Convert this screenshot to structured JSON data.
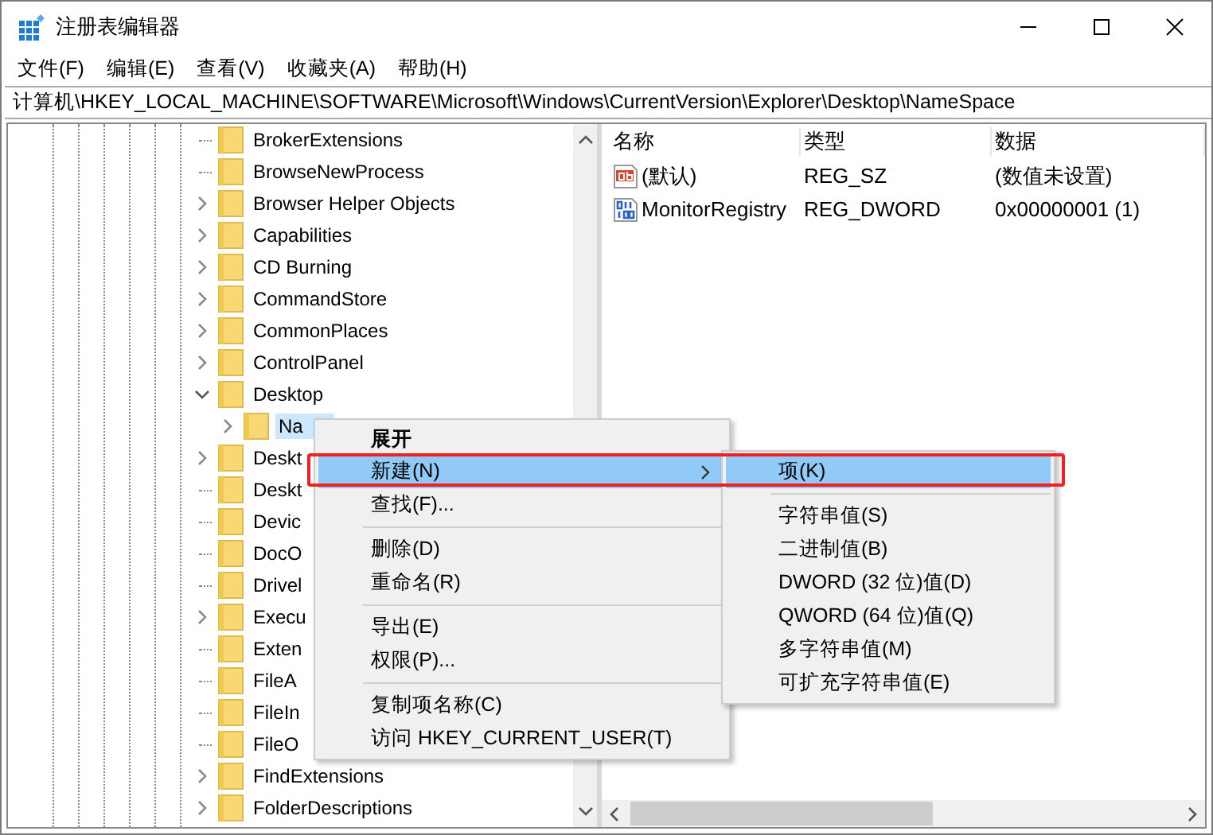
{
  "window": {
    "title": "注册表编辑器"
  },
  "menu_bar": [
    "文件(F)",
    "编辑(E)",
    "查看(V)",
    "收藏夹(A)",
    "帮助(H)"
  ],
  "address": "计算机\\HKEY_LOCAL_MACHINE\\SOFTWARE\\Microsoft\\Windows\\CurrentVersion\\Explorer\\Desktop\\NameSpace",
  "tree": [
    {
      "label": "BrokerExtensions",
      "kind": "leaf",
      "selected": false
    },
    {
      "label": "BrowseNewProcess",
      "kind": "leaf",
      "selected": false
    },
    {
      "label": "Browser Helper Objects",
      "kind": "closed",
      "selected": false
    },
    {
      "label": "Capabilities",
      "kind": "closed",
      "selected": false
    },
    {
      "label": "CD Burning",
      "kind": "closed",
      "selected": false
    },
    {
      "label": "CommandStore",
      "kind": "closed",
      "selected": false
    },
    {
      "label": "CommonPlaces",
      "kind": "closed",
      "selected": false
    },
    {
      "label": "ControlPanel",
      "kind": "closed",
      "selected": false
    },
    {
      "label": "Desktop",
      "kind": "open",
      "selected": false,
      "children": [
        {
          "label": "Na",
          "kind": "closed",
          "selected": true
        }
      ]
    },
    {
      "label": "Deskt",
      "kind": "closed",
      "selected": false
    },
    {
      "label": "Deskt",
      "kind": "leaf",
      "selected": false
    },
    {
      "label": "Devic",
      "kind": "leaf",
      "selected": false
    },
    {
      "label": "DocO",
      "kind": "leaf",
      "selected": false
    },
    {
      "label": "Drivel",
      "kind": "leaf",
      "selected": false
    },
    {
      "label": "Execu",
      "kind": "closed",
      "selected": false
    },
    {
      "label": "Exten",
      "kind": "leaf",
      "selected": false
    },
    {
      "label": "FileA",
      "kind": "leaf",
      "selected": false
    },
    {
      "label": "FileIn",
      "kind": "leaf",
      "selected": false
    },
    {
      "label": "FileO",
      "kind": "leaf",
      "selected": false
    },
    {
      "label": "FindExtensions",
      "kind": "closed",
      "selected": false
    },
    {
      "label": "FolderDescriptions",
      "kind": "closed",
      "selected": false
    }
  ],
  "values": {
    "columns": [
      "名称",
      "类型",
      "数据"
    ],
    "rows": [
      {
        "kind": "string",
        "name": "(默认)",
        "type": "REG_SZ",
        "data": "(数值未设置)"
      },
      {
        "kind": "binary",
        "name": "MonitorRegistry",
        "type": "REG_DWORD",
        "data": "0x00000001 (1)"
      }
    ]
  },
  "context_menu": [
    {
      "kind": "item",
      "label": "展开",
      "bold": true,
      "selected": false,
      "submenu": false
    },
    {
      "kind": "item",
      "label": "新建(N)",
      "bold": false,
      "selected": true,
      "submenu": true
    },
    {
      "kind": "item",
      "label": "查找(F)...",
      "bold": false,
      "selected": false,
      "submenu": false
    },
    {
      "kind": "separator"
    },
    {
      "kind": "item",
      "label": "删除(D)",
      "bold": false,
      "selected": false,
      "submenu": false
    },
    {
      "kind": "item",
      "label": "重命名(R)",
      "bold": false,
      "selected": false,
      "submenu": false
    },
    {
      "kind": "separator"
    },
    {
      "kind": "item",
      "label": "导出(E)",
      "bold": false,
      "selected": false,
      "submenu": false
    },
    {
      "kind": "item",
      "label": "权限(P)...",
      "bold": false,
      "selected": false,
      "submenu": false
    },
    {
      "kind": "separator"
    },
    {
      "kind": "item",
      "label": "复制项名称(C)",
      "bold": false,
      "selected": false,
      "submenu": false
    },
    {
      "kind": "item",
      "label": "访问 HKEY_CURRENT_USER(T)",
      "bold": false,
      "selected": false,
      "submenu": false
    }
  ],
  "submenu": [
    {
      "kind": "item",
      "label": "项(K)",
      "selected": true
    },
    {
      "kind": "separator"
    },
    {
      "kind": "item",
      "label": "字符串值(S)",
      "selected": false
    },
    {
      "kind": "item",
      "label": "二进制值(B)",
      "selected": false
    },
    {
      "kind": "item",
      "label": "DWORD (32 位)值(D)",
      "selected": false
    },
    {
      "kind": "item",
      "label": "QWORD (64 位)值(Q)",
      "selected": false
    },
    {
      "kind": "item",
      "label": "多字符串值(M)",
      "selected": false
    },
    {
      "kind": "item",
      "label": "可扩充字符串值(E)",
      "selected": false
    }
  ]
}
